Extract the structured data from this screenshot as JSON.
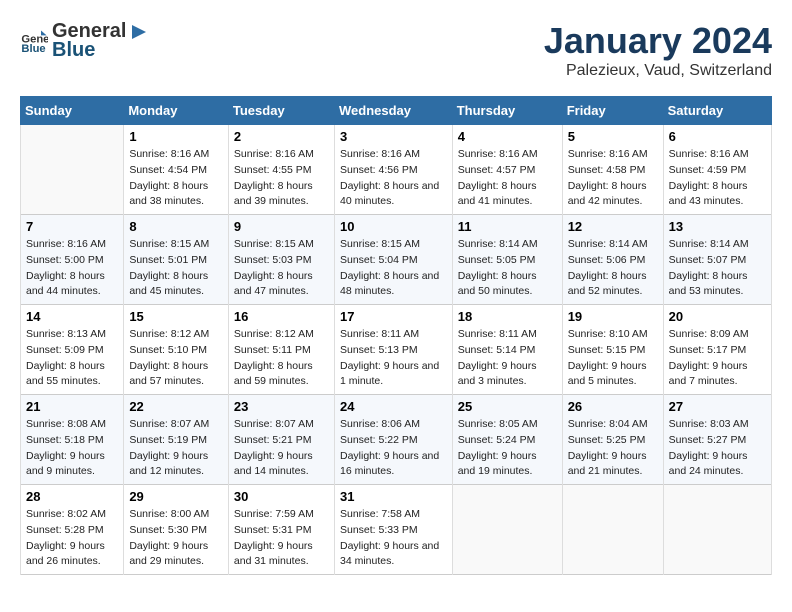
{
  "header": {
    "logo_general": "General",
    "logo_blue": "Blue",
    "title": "January 2024",
    "subtitle": "Palezieux, Vaud, Switzerland"
  },
  "weekdays": [
    "Sunday",
    "Monday",
    "Tuesday",
    "Wednesday",
    "Thursday",
    "Friday",
    "Saturday"
  ],
  "weeks": [
    [
      {
        "day": "",
        "sunrise": "",
        "sunset": "",
        "daylight": ""
      },
      {
        "day": "1",
        "sunrise": "Sunrise: 8:16 AM",
        "sunset": "Sunset: 4:54 PM",
        "daylight": "Daylight: 8 hours and 38 minutes."
      },
      {
        "day": "2",
        "sunrise": "Sunrise: 8:16 AM",
        "sunset": "Sunset: 4:55 PM",
        "daylight": "Daylight: 8 hours and 39 minutes."
      },
      {
        "day": "3",
        "sunrise": "Sunrise: 8:16 AM",
        "sunset": "Sunset: 4:56 PM",
        "daylight": "Daylight: 8 hours and 40 minutes."
      },
      {
        "day": "4",
        "sunrise": "Sunrise: 8:16 AM",
        "sunset": "Sunset: 4:57 PM",
        "daylight": "Daylight: 8 hours and 41 minutes."
      },
      {
        "day": "5",
        "sunrise": "Sunrise: 8:16 AM",
        "sunset": "Sunset: 4:58 PM",
        "daylight": "Daylight: 8 hours and 42 minutes."
      },
      {
        "day": "6",
        "sunrise": "Sunrise: 8:16 AM",
        "sunset": "Sunset: 4:59 PM",
        "daylight": "Daylight: 8 hours and 43 minutes."
      }
    ],
    [
      {
        "day": "7",
        "sunrise": "Sunrise: 8:16 AM",
        "sunset": "Sunset: 5:00 PM",
        "daylight": "Daylight: 8 hours and 44 minutes."
      },
      {
        "day": "8",
        "sunrise": "Sunrise: 8:15 AM",
        "sunset": "Sunset: 5:01 PM",
        "daylight": "Daylight: 8 hours and 45 minutes."
      },
      {
        "day": "9",
        "sunrise": "Sunrise: 8:15 AM",
        "sunset": "Sunset: 5:03 PM",
        "daylight": "Daylight: 8 hours and 47 minutes."
      },
      {
        "day": "10",
        "sunrise": "Sunrise: 8:15 AM",
        "sunset": "Sunset: 5:04 PM",
        "daylight": "Daylight: 8 hours and 48 minutes."
      },
      {
        "day": "11",
        "sunrise": "Sunrise: 8:14 AM",
        "sunset": "Sunset: 5:05 PM",
        "daylight": "Daylight: 8 hours and 50 minutes."
      },
      {
        "day": "12",
        "sunrise": "Sunrise: 8:14 AM",
        "sunset": "Sunset: 5:06 PM",
        "daylight": "Daylight: 8 hours and 52 minutes."
      },
      {
        "day": "13",
        "sunrise": "Sunrise: 8:14 AM",
        "sunset": "Sunset: 5:07 PM",
        "daylight": "Daylight: 8 hours and 53 minutes."
      }
    ],
    [
      {
        "day": "14",
        "sunrise": "Sunrise: 8:13 AM",
        "sunset": "Sunset: 5:09 PM",
        "daylight": "Daylight: 8 hours and 55 minutes."
      },
      {
        "day": "15",
        "sunrise": "Sunrise: 8:12 AM",
        "sunset": "Sunset: 5:10 PM",
        "daylight": "Daylight: 8 hours and 57 minutes."
      },
      {
        "day": "16",
        "sunrise": "Sunrise: 8:12 AM",
        "sunset": "Sunset: 5:11 PM",
        "daylight": "Daylight: 8 hours and 59 minutes."
      },
      {
        "day": "17",
        "sunrise": "Sunrise: 8:11 AM",
        "sunset": "Sunset: 5:13 PM",
        "daylight": "Daylight: 9 hours and 1 minute."
      },
      {
        "day": "18",
        "sunrise": "Sunrise: 8:11 AM",
        "sunset": "Sunset: 5:14 PM",
        "daylight": "Daylight: 9 hours and 3 minutes."
      },
      {
        "day": "19",
        "sunrise": "Sunrise: 8:10 AM",
        "sunset": "Sunset: 5:15 PM",
        "daylight": "Daylight: 9 hours and 5 minutes."
      },
      {
        "day": "20",
        "sunrise": "Sunrise: 8:09 AM",
        "sunset": "Sunset: 5:17 PM",
        "daylight": "Daylight: 9 hours and 7 minutes."
      }
    ],
    [
      {
        "day": "21",
        "sunrise": "Sunrise: 8:08 AM",
        "sunset": "Sunset: 5:18 PM",
        "daylight": "Daylight: 9 hours and 9 minutes."
      },
      {
        "day": "22",
        "sunrise": "Sunrise: 8:07 AM",
        "sunset": "Sunset: 5:19 PM",
        "daylight": "Daylight: 9 hours and 12 minutes."
      },
      {
        "day": "23",
        "sunrise": "Sunrise: 8:07 AM",
        "sunset": "Sunset: 5:21 PM",
        "daylight": "Daylight: 9 hours and 14 minutes."
      },
      {
        "day": "24",
        "sunrise": "Sunrise: 8:06 AM",
        "sunset": "Sunset: 5:22 PM",
        "daylight": "Daylight: 9 hours and 16 minutes."
      },
      {
        "day": "25",
        "sunrise": "Sunrise: 8:05 AM",
        "sunset": "Sunset: 5:24 PM",
        "daylight": "Daylight: 9 hours and 19 minutes."
      },
      {
        "day": "26",
        "sunrise": "Sunrise: 8:04 AM",
        "sunset": "Sunset: 5:25 PM",
        "daylight": "Daylight: 9 hours and 21 minutes."
      },
      {
        "day": "27",
        "sunrise": "Sunrise: 8:03 AM",
        "sunset": "Sunset: 5:27 PM",
        "daylight": "Daylight: 9 hours and 24 minutes."
      }
    ],
    [
      {
        "day": "28",
        "sunrise": "Sunrise: 8:02 AM",
        "sunset": "Sunset: 5:28 PM",
        "daylight": "Daylight: 9 hours and 26 minutes."
      },
      {
        "day": "29",
        "sunrise": "Sunrise: 8:00 AM",
        "sunset": "Sunset: 5:30 PM",
        "daylight": "Daylight: 9 hours and 29 minutes."
      },
      {
        "day": "30",
        "sunrise": "Sunrise: 7:59 AM",
        "sunset": "Sunset: 5:31 PM",
        "daylight": "Daylight: 9 hours and 31 minutes."
      },
      {
        "day": "31",
        "sunrise": "Sunrise: 7:58 AM",
        "sunset": "Sunset: 5:33 PM",
        "daylight": "Daylight: 9 hours and 34 minutes."
      },
      {
        "day": "",
        "sunrise": "",
        "sunset": "",
        "daylight": ""
      },
      {
        "day": "",
        "sunrise": "",
        "sunset": "",
        "daylight": ""
      },
      {
        "day": "",
        "sunrise": "",
        "sunset": "",
        "daylight": ""
      }
    ]
  ]
}
